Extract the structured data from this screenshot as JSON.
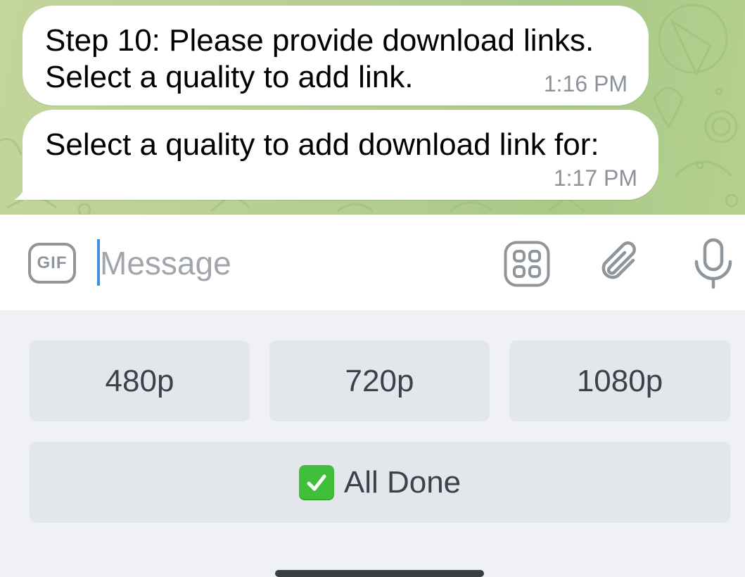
{
  "chat": {
    "messages": [
      {
        "text": "Step 10: Please provide download links.\nSelect a quality to add link.",
        "time": "1:16 PM"
      },
      {
        "text": "Select a quality to add download link for:",
        "time": "1:17 PM"
      }
    ]
  },
  "input_bar": {
    "gif_label": "GIF",
    "message_placeholder": "Message",
    "message_value": "",
    "icons": [
      "gif-icon",
      "stickers-icon",
      "paperclip-icon",
      "microphone-icon"
    ]
  },
  "keyboard": {
    "row1": [
      "480p",
      "720p",
      "1080p"
    ],
    "done_label": "All Done",
    "done_icon": "check-mark-icon"
  },
  "colors": {
    "wallpaper": "#b6ce93",
    "bubble": "#ffffff",
    "caret": "#3f8fe0",
    "keyboard_button": "#e3e6ea",
    "check": "#3fbf3a"
  }
}
